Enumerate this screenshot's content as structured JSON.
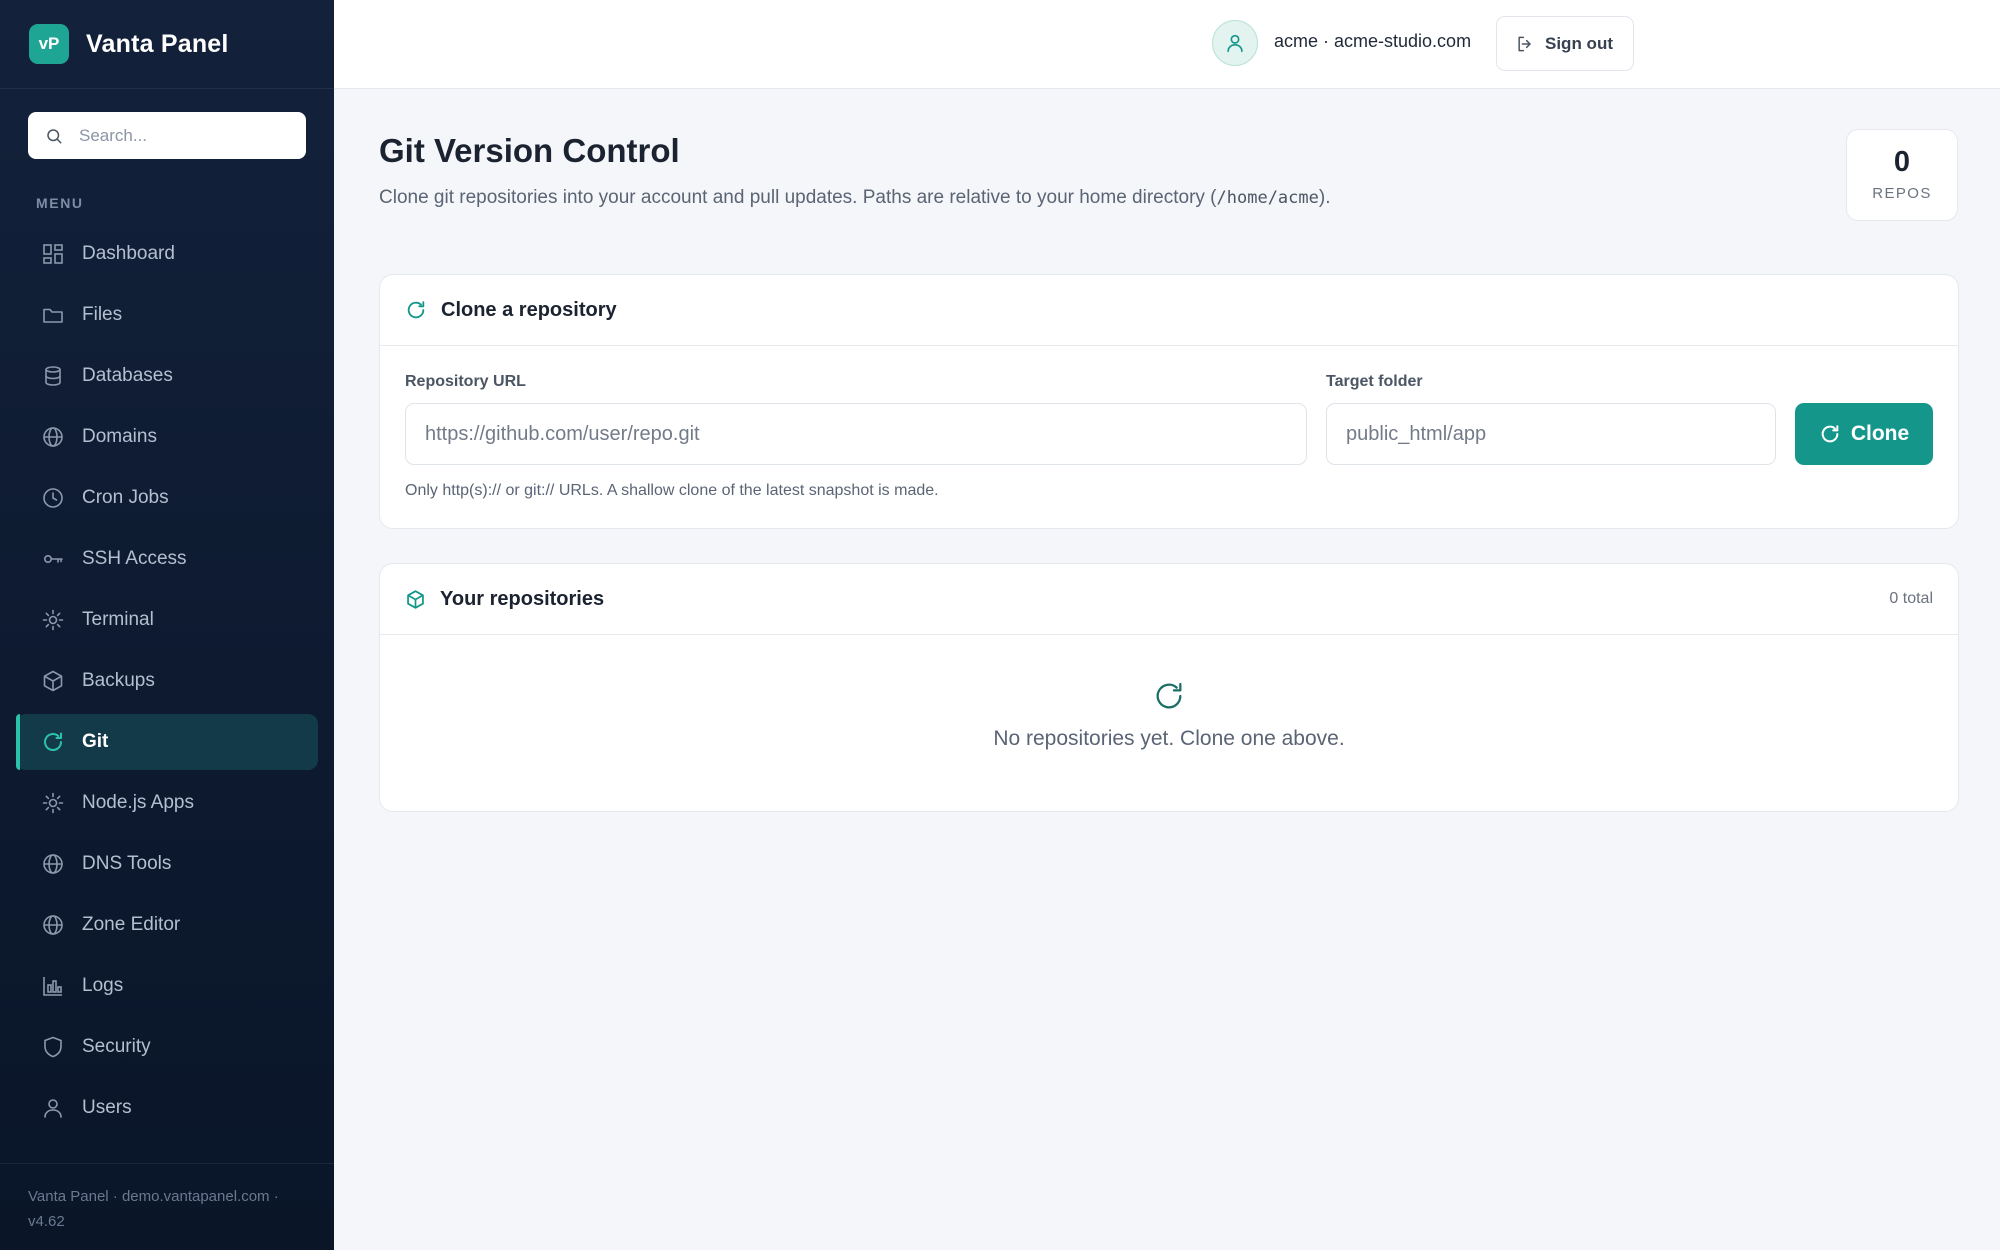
{
  "brand": {
    "logo_text": "vP",
    "name": "Vanta Panel"
  },
  "search": {
    "placeholder": "Search..."
  },
  "sidebar": {
    "menu_heading": "MENU",
    "items": [
      {
        "label": "Dashboard",
        "icon": "dashboard-icon"
      },
      {
        "label": "Files",
        "icon": "folder-icon"
      },
      {
        "label": "Databases",
        "icon": "database-icon"
      },
      {
        "label": "Domains",
        "icon": "globe-icon"
      },
      {
        "label": "Cron Jobs",
        "icon": "clock-icon"
      },
      {
        "label": "SSH Access",
        "icon": "key-icon"
      },
      {
        "label": "Terminal",
        "icon": "gear-icon"
      },
      {
        "label": "Backups",
        "icon": "box-icon"
      },
      {
        "label": "Git",
        "icon": "refresh-icon",
        "active": true
      },
      {
        "label": "Node.js Apps",
        "icon": "gear-icon"
      },
      {
        "label": "DNS Tools",
        "icon": "globe-icon"
      },
      {
        "label": "Zone Editor",
        "icon": "globe-icon"
      },
      {
        "label": "Logs",
        "icon": "bar-chart-icon"
      },
      {
        "label": "Security",
        "icon": "shield-icon"
      },
      {
        "label": "Users",
        "icon": "user-icon"
      }
    ],
    "footer_line1": "Vanta Panel · demo.vantapanel.com ·",
    "footer_line2": "v4.62"
  },
  "topbar": {
    "account": "acme · acme-studio.com",
    "signout_label": "Sign out"
  },
  "page": {
    "title": "Git Version Control",
    "subtitle_prefix": "Clone git repositories into your account and pull updates. Paths are relative to your home directory (",
    "subtitle_path": "/home/acme",
    "subtitle_suffix": ").",
    "stat_value": "0",
    "stat_label": "REPOS"
  },
  "clone": {
    "title": "Clone a repository",
    "url_label": "Repository URL",
    "url_placeholder": "https://github.com/user/repo.git",
    "url_value": "",
    "folder_label": "Target folder",
    "folder_placeholder": "public_html/app",
    "folder_value": "",
    "button_label": "Clone",
    "hint": "Only http(s):// or git:// URLs. A shallow clone of the latest snapshot is made."
  },
  "repos": {
    "title": "Your repositories",
    "total": "0 total",
    "empty_text": "No repositories yet. Clone one above."
  },
  "colors": {
    "accent": "#14978a",
    "active_indicator": "#2cc2a9",
    "sidebar_bg": "#0d1a30"
  }
}
